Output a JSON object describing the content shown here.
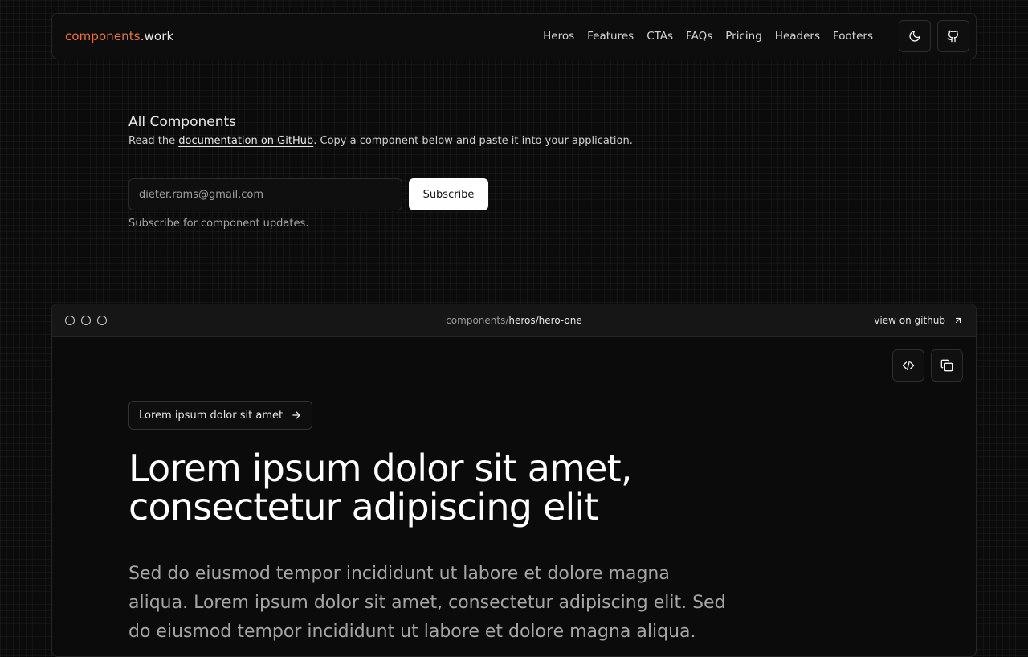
{
  "brand": {
    "accent": "components",
    "rest": ".work"
  },
  "nav": {
    "links": [
      "Heros",
      "Features",
      "CTAs",
      "FAQs",
      "Pricing",
      "Headers",
      "Footers"
    ],
    "theme_icon": "moon-icon",
    "github_icon": "github-icon"
  },
  "intro": {
    "title": "All Components",
    "desc_prefix": "Read the ",
    "desc_link": "documentation on GitHub",
    "desc_suffix": ". Copy a component below and paste it into your application."
  },
  "subscribe": {
    "placeholder": "dieter.rams@gmail.com",
    "button": "Subscribe",
    "hint": "Subscribe for component updates."
  },
  "preview": {
    "path_dim": "components/",
    "path_bright": "heros/hero-one",
    "github_label": "view on github",
    "hero": {
      "badge": "Lorem ipsum dolor sit amet",
      "title": "Lorem ipsum dolor sit amet, consectetur adipiscing elit",
      "text": "Sed do eiusmod tempor incididunt ut labore et dolore magna aliqua. Lorem ipsum dolor sit amet, consectetur adipiscing elit. Sed do eiusmod tempor incididunt ut labore et dolore magna aliqua."
    }
  },
  "colors": {
    "accent": "#e8743b",
    "background": "#0b0b0b",
    "button_bg": "#ffffff"
  }
}
